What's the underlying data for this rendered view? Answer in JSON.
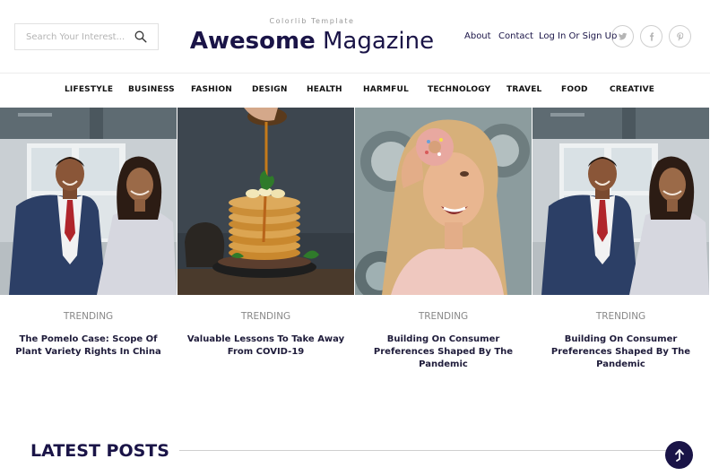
{
  "header": {
    "search": {
      "placeholder": "Search Your Interest...",
      "icon": "search-icon"
    },
    "brand": {
      "tagline": "Colorlib Template",
      "name_bold": "Awesome",
      "name_regular": "Magazine"
    },
    "links": [
      "About",
      "Contact",
      "Log In Or Sign Up"
    ],
    "social": [
      {
        "name": "twitter-icon",
        "glyph": "t"
      },
      {
        "name": "facebook-icon",
        "glyph": "f"
      },
      {
        "name": "pinterest-icon",
        "glyph": "p"
      }
    ]
  },
  "nav": {
    "items": [
      "LIFESTYLE",
      "BUSINESS",
      "FASHION",
      "DESIGN",
      "HEALTH",
      "HARMFUL",
      "TECHNOLOGY",
      "TRAVEL",
      "FOOD",
      "CREATIVE"
    ]
  },
  "cards": [
    {
      "category": "TRENDING",
      "title": "The Pomelo Case: Scope Of Plant Variety Rights In China"
    },
    {
      "category": "TRENDING",
      "title": "Valuable Lessons To Take Away From COVID-19"
    },
    {
      "category": "TRENDING",
      "title": "Building On Consumer Preferences Shaped By The Pandemic"
    },
    {
      "category": "TRENDING",
      "title": "Building On Consumer Preferences Shaped By The Pandemic"
    }
  ],
  "latest": {
    "heading": "LATEST POSTS"
  },
  "colors": {
    "brand": "#1a1447",
    "muted": "#888888",
    "border": "#e1e1e1"
  }
}
